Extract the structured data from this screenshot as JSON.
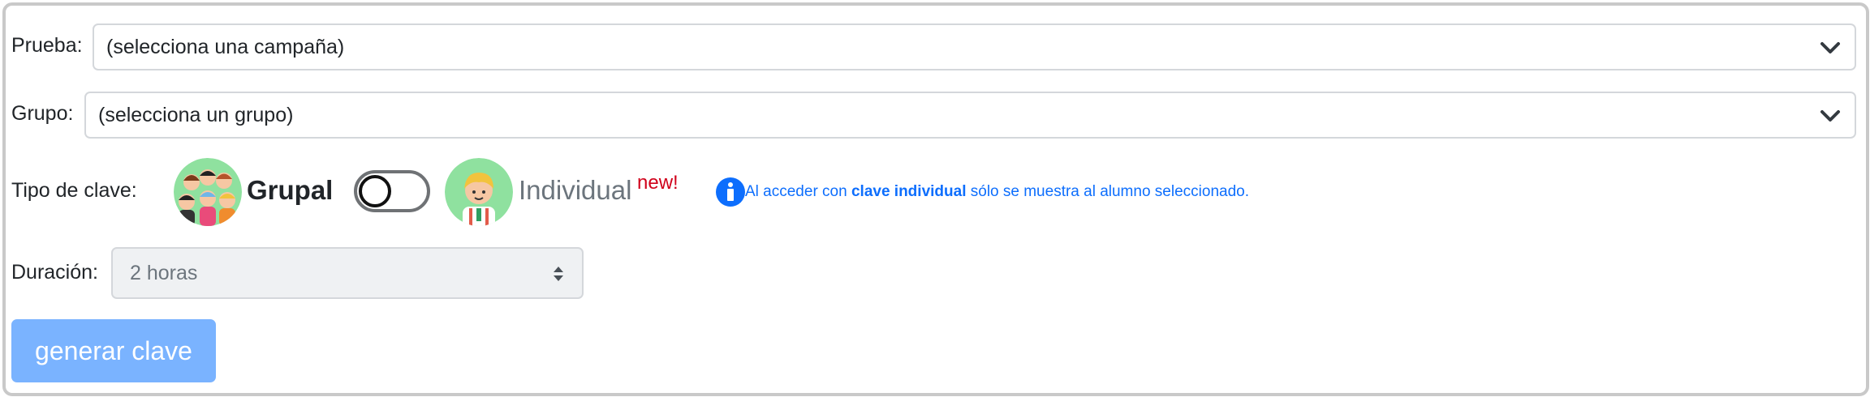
{
  "prueba": {
    "label": "Prueba:",
    "selected": "(selecciona una campaña)"
  },
  "grupo": {
    "label": "Grupo:",
    "selected": "(selecciona un grupo)"
  },
  "tipo": {
    "label": "Tipo de clave:",
    "grupal_label": "Grupal",
    "individual_label": "Individual",
    "new_badge": "new!",
    "toggle_state": "off",
    "info_prefix": "Al acceder con ",
    "info_bold": "clave individual",
    "info_suffix": " sólo se muestra al alumno seleccionado."
  },
  "duracion": {
    "label": "Duración:",
    "selected": "2 horas"
  },
  "actions": {
    "generate_label": "generar clave"
  },
  "colors": {
    "primary_disabled": "#7ab3ff",
    "info_blue": "#0d6efd",
    "new_red": "#d0021b",
    "avatar_green": "#8fe19f"
  },
  "icons": {
    "select_caret": "chevron-down-icon",
    "info": "info-circle-icon",
    "duration_caret": "up-down-icon"
  }
}
